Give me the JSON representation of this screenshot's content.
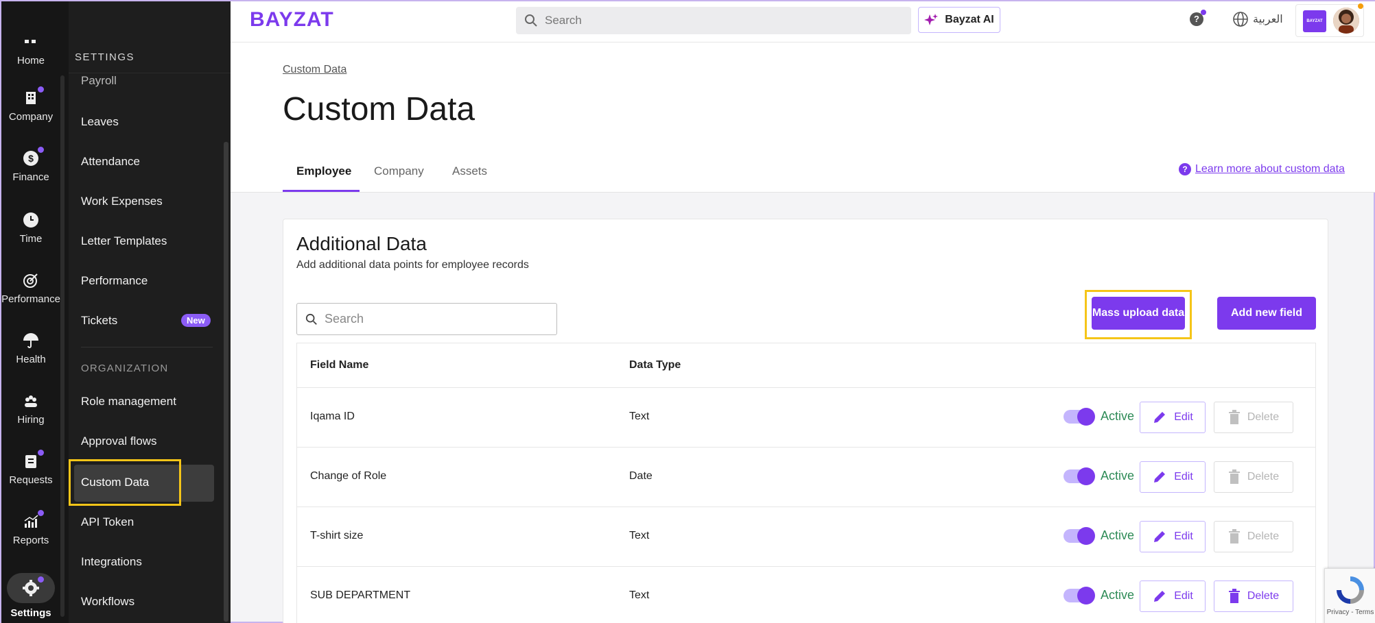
{
  "rail": {
    "items": [
      {
        "label": "Home",
        "icon": "home-icon"
      },
      {
        "label": "Company",
        "icon": "building-icon"
      },
      {
        "label": "Finance",
        "icon": "dollar-icon"
      },
      {
        "label": "Time",
        "icon": "clock-icon"
      },
      {
        "label": "Performance",
        "icon": "target-icon"
      },
      {
        "label": "Health",
        "icon": "umbrella-icon"
      },
      {
        "label": "Hiring",
        "icon": "people-icon"
      },
      {
        "label": "Requests",
        "icon": "clipboard-icon"
      },
      {
        "label": "Reports",
        "icon": "chart-icon"
      },
      {
        "label": "Settings",
        "icon": "gear-icon"
      }
    ]
  },
  "settings_panel": {
    "title": "SETTINGS",
    "items": [
      "Payroll",
      "Leaves",
      "Attendance",
      "Work Expenses",
      "Letter Templates",
      "Performance",
      "Tickets"
    ],
    "new_badge": "New",
    "section_label": "ORGANIZATION",
    "org_items": [
      "Role management",
      "Approval flows",
      "Custom Data",
      "API Token",
      "Integrations",
      "Workflows"
    ]
  },
  "header": {
    "logo": "BAYZAT",
    "search_placeholder": "Search",
    "ai_button": "Bayzat AI",
    "help": "?",
    "language": "العربية",
    "org_logo": "BAYZAT"
  },
  "page": {
    "breadcrumb": "Custom Data",
    "title": "Custom Data",
    "tabs": [
      "Employee",
      "Company",
      "Assets"
    ],
    "learn_more": "Learn more about custom data"
  },
  "card": {
    "title": "Additional Data",
    "subtitle": "Add additional data points for employee records",
    "search_placeholder": "Search",
    "mass_upload": "Mass upload data",
    "add_field": "Add new field",
    "columns": [
      "Field Name",
      "Data Type"
    ],
    "rows": [
      {
        "name": "Iqama ID",
        "type": "Text",
        "status": "Active",
        "edit": "Edit",
        "delete": "Delete"
      },
      {
        "name": "Change of Role",
        "type": "Date",
        "status": "Active",
        "edit": "Edit",
        "delete": "Delete"
      },
      {
        "name": "T-shirt size",
        "type": "Text",
        "status": "Active",
        "edit": "Edit",
        "delete": "Delete"
      },
      {
        "name": "SUB DEPARTMENT",
        "type": "Text",
        "status": "Active",
        "edit": "Edit",
        "delete": "Delete"
      }
    ]
  },
  "recaptcha": {
    "text": "Privacy - Terms"
  },
  "colors": {
    "accent": "#7c3aed",
    "active": "#2e8b57",
    "highlight": "#f5c518"
  }
}
